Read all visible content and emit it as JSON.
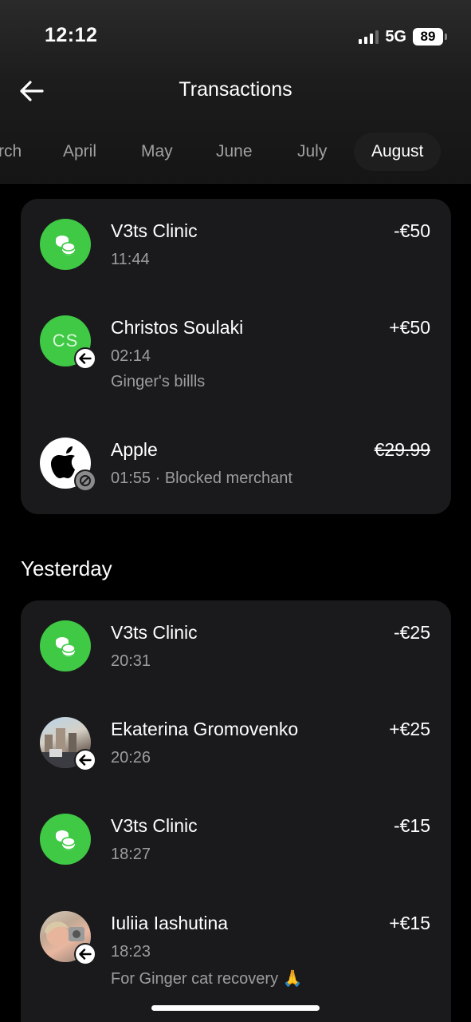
{
  "status_bar": {
    "time": "12:12",
    "network": "5G",
    "battery": "89"
  },
  "header": {
    "title": "Transactions",
    "back_icon": "arrow-left-icon"
  },
  "months": [
    {
      "label": "rch",
      "active": false
    },
    {
      "label": "April",
      "active": false
    },
    {
      "label": "May",
      "active": false
    },
    {
      "label": "June",
      "active": false
    },
    {
      "label": "July",
      "active": false
    },
    {
      "label": "August",
      "active": true
    }
  ],
  "today": {
    "transactions": [
      {
        "name": "V3ts Clinic",
        "time": "11:44",
        "amount": "-€50",
        "icon": "coins-icon"
      },
      {
        "name": "Christos Soulaki",
        "initials": "CS",
        "time": "02:14",
        "note": "Ginger's billls",
        "amount": "+€50",
        "badge": "incoming-arrow-icon"
      },
      {
        "name": "Apple",
        "time": "01:55 · Blocked merchant",
        "amount": "€29.99",
        "icon": "apple-logo-icon",
        "badge": "blocked-icon",
        "struck": true
      }
    ]
  },
  "yesterday": {
    "title": "Yesterday",
    "transactions": [
      {
        "name": "V3ts Clinic",
        "time": "20:31",
        "amount": "-€25",
        "icon": "coins-icon"
      },
      {
        "name": "Ekaterina Gromovenko",
        "time": "20:26",
        "amount": "+€25",
        "badge": "incoming-arrow-icon"
      },
      {
        "name": "V3ts Clinic",
        "time": "18:27",
        "amount": "-€15",
        "icon": "coins-icon"
      },
      {
        "name": "Iuliia Iashutina",
        "time": "18:23",
        "note": "For Ginger cat recovery 🙏",
        "amount": "+€15",
        "badge": "incoming-arrow-icon"
      }
    ]
  },
  "colors": {
    "accent_green": "#3fc945",
    "card_bg": "#1a1a1c",
    "muted_text": "#9d9d9d"
  }
}
